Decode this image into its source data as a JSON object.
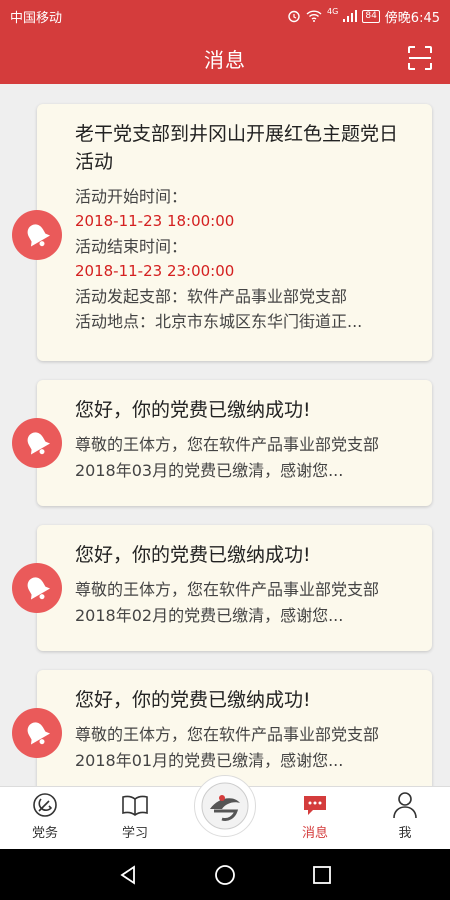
{
  "status_bar": {
    "carrier": "中国移动",
    "network": "4G",
    "battery": "84",
    "time": "傍晚6:45"
  },
  "header": {
    "title": "消息"
  },
  "messages": [
    {
      "title": "老干党支部到井冈山开展红色主题党日活动",
      "start_label": "活动开始时间：",
      "start_value": "2018-11-23 18:00:00",
      "end_label": "活动结束时间：",
      "end_value": "2018-11-23 23:00:00",
      "branch": "活动发起支部：软件产品事业部党支部",
      "location": "活动地点：北京市东城区东华门街道正..."
    },
    {
      "title": "您好，你的党费已缴纳成功!",
      "desc": "尊敬的王体方，您在软件产品事业部党支部2018年03月的党费已缴清，感谢您..."
    },
    {
      "title": "您好，你的党费已缴纳成功!",
      "desc": "尊敬的王体方，您在软件产品事业部党支部2018年02月的党费已缴清，感谢您..."
    },
    {
      "title": "您好，你的党费已缴纳成功!",
      "desc": "尊敬的王体方，您在软件产品事业部党支部2018年01月的党费已缴清，感谢您..."
    }
  ],
  "tabbar": {
    "items": [
      {
        "label": "党务",
        "icon": "party-emblem-icon"
      },
      {
        "label": "学习",
        "icon": "book-icon"
      },
      {
        "label": "",
        "icon": "center-logo-icon"
      },
      {
        "label": "消息",
        "icon": "message-icon",
        "active": true
      },
      {
        "label": "我",
        "icon": "user-icon"
      }
    ]
  },
  "colors": {
    "primary_red": "#d43c3c",
    "bell_red": "#ea5a5a",
    "date_red": "#d42020",
    "card_bg": "#fcf9ec"
  }
}
